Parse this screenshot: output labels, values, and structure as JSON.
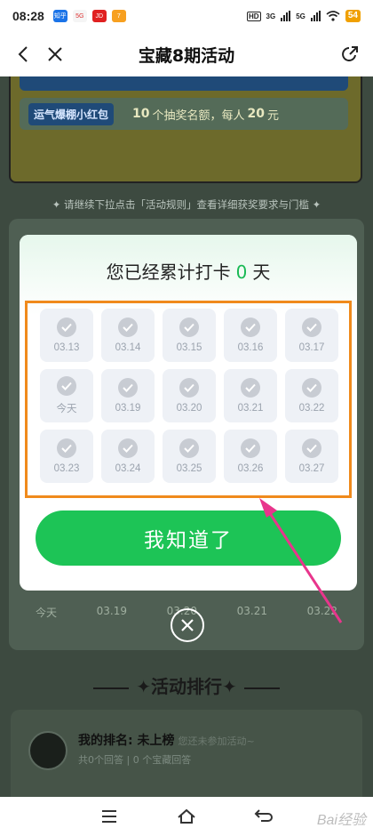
{
  "status_bar": {
    "time": "08:28",
    "apps": [
      {
        "name": "zhihu-app-icon",
        "text": "知乎",
        "color": "#1a73e8"
      },
      {
        "name": "5g-app-icon",
        "text": "5G",
        "color": "#f5f5f5"
      },
      {
        "name": "jingdong-app-icon",
        "text": "JD",
        "color": "#e02020"
      },
      {
        "name": "calendar-app-icon",
        "text": "7",
        "color": "#f7a020"
      }
    ],
    "hd_label": "HD",
    "net1": "3G",
    "net2": "5G",
    "battery": "54"
  },
  "nav": {
    "title": "宝藏8期活动"
  },
  "background_page": {
    "reward_tag": "运气爆棚小红包",
    "reward_count": "10",
    "reward_text_a": "个抽奖名额，每人",
    "reward_amount": "20",
    "reward_unit": "元",
    "hint": "请继续下拉点击「活动规则」查看详细获奖要求与门槛",
    "days_row": [
      "今天",
      "03.19",
      "03.20",
      "03.21",
      "03.22"
    ],
    "rank_title": "✦活动排行✦",
    "rank_label": "我的排名:",
    "rank_value": "未上榜",
    "rank_note": "您还未参加活动~",
    "rank_sub": "共0个回答 | 0 个宝藏回答"
  },
  "modal": {
    "title_prefix": "您已经累计打卡",
    "count": "0",
    "title_suffix": "天",
    "days": [
      "03.13",
      "03.14",
      "03.15",
      "03.16",
      "03.17",
      "今天",
      "03.19",
      "03.20",
      "03.21",
      "03.22",
      "03.23",
      "03.24",
      "03.25",
      "03.26",
      "03.27"
    ],
    "confirm_label": "我知道了"
  },
  "colors": {
    "accent_green": "#1dc456",
    "highlight_orange": "#f08a1c",
    "arrow_pink": "#e8358c"
  },
  "watermark": "Bai经验"
}
